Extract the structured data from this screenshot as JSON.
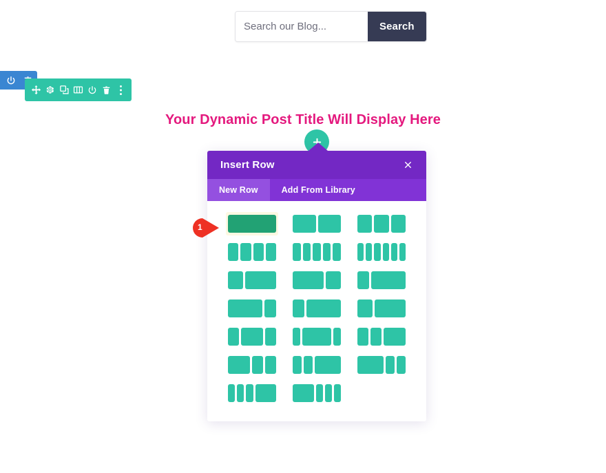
{
  "search": {
    "placeholder": "Search our Blog...",
    "value": "",
    "button_label": "Search"
  },
  "toolbars": {
    "section_toolbar": {
      "color": "#3a86d2",
      "icons": [
        "power-icon",
        "trash-icon"
      ]
    },
    "row_toolbar": {
      "color": "#2ec4a6",
      "icons": [
        "move-icon",
        "gear-icon",
        "duplicate-icon",
        "columns-icon",
        "power-icon",
        "trash-icon",
        "more-options-icon"
      ]
    }
  },
  "post_title": {
    "text": "Your Dynamic Post Title Will Display Here",
    "color": "#e4197e"
  },
  "add_row_button": {
    "icon": "plus-icon",
    "color": "#2ec4a6"
  },
  "modal": {
    "title": "Insert Row",
    "close_icon": "close-icon",
    "header_color": "#7328c4",
    "tabs": [
      {
        "label": "New Row",
        "active": true
      },
      {
        "label": "Add From Library",
        "active": false
      }
    ],
    "layouts": [
      {
        "name": "1-column",
        "columns": [
          1
        ],
        "highlighted": true
      },
      {
        "name": "2-column-equal",
        "columns": [
          1,
          1
        ],
        "highlighted": false
      },
      {
        "name": "3-column-equal",
        "columns": [
          1,
          1,
          1
        ],
        "highlighted": false
      },
      {
        "name": "4-column-equal",
        "columns": [
          1,
          1,
          1,
          1
        ],
        "highlighted": false
      },
      {
        "name": "5-column-equal",
        "columns": [
          1,
          1,
          1,
          1,
          1
        ],
        "highlighted": false
      },
      {
        "name": "6-column-equal",
        "columns": [
          1,
          1,
          1,
          1,
          1,
          1
        ],
        "highlighted": false
      },
      {
        "name": "one-third-two-thirds",
        "columns": [
          1,
          2
        ],
        "highlighted": false
      },
      {
        "name": "two-thirds-one-third",
        "columns": [
          2,
          1
        ],
        "highlighted": false
      },
      {
        "name": "one-quarter-three-quarters",
        "columns": [
          1,
          3
        ],
        "highlighted": false
      },
      {
        "name": "three-quarters-one-quarter",
        "columns": [
          3,
          1
        ],
        "highlighted": false
      },
      {
        "name": "one-quarter-three-quarters-b",
        "columns": [
          1,
          3
        ],
        "highlighted": false
      },
      {
        "name": "one-third-two-thirds-b",
        "columns": [
          1,
          2
        ],
        "highlighted": false
      },
      {
        "name": "quarter-half-quarter",
        "columns": [
          1,
          2,
          1
        ],
        "highlighted": false
      },
      {
        "name": "sixth-two-thirds-sixth",
        "columns": [
          1,
          4,
          1
        ],
        "highlighted": false
      },
      {
        "name": "quarter-quarter-half",
        "columns": [
          1,
          1,
          2
        ],
        "highlighted": false
      },
      {
        "name": "half-quarter-quarter",
        "columns": [
          2,
          1,
          1
        ],
        "highlighted": false
      },
      {
        "name": "sixth-sixth-two-thirds",
        "columns": [
          1,
          1,
          3
        ],
        "highlighted": false
      },
      {
        "name": "two-thirds-sixth-sixth",
        "columns": [
          3,
          1,
          1
        ],
        "highlighted": false
      },
      {
        "name": "sixth-sixth-sixth-half",
        "columns": [
          1,
          1,
          1,
          3
        ],
        "highlighted": false
      },
      {
        "name": "half-sixth-sixth-sixth",
        "columns": [
          3,
          1,
          1,
          1
        ],
        "highlighted": false
      }
    ]
  },
  "marker": {
    "number": "1",
    "color": "#ee3124"
  }
}
